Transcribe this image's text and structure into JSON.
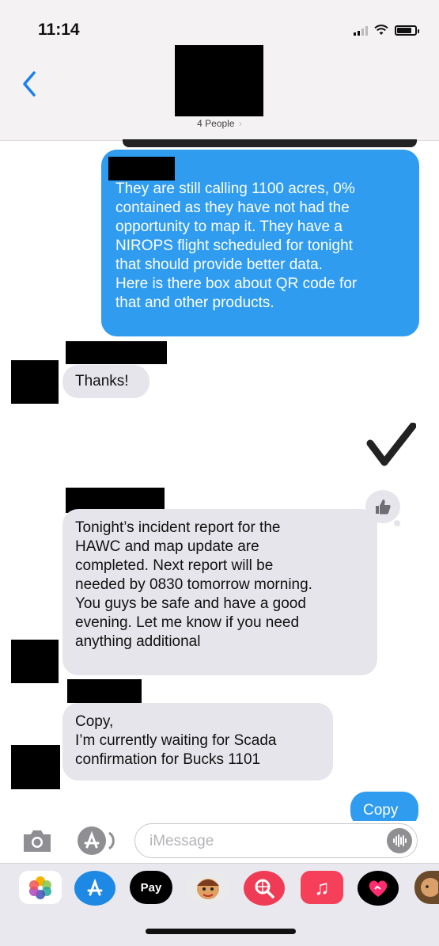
{
  "status_bar": {
    "time": "11:14"
  },
  "header": {
    "people_label": "4 People",
    "chevron": "›"
  },
  "messages": {
    "outgoing_1": {
      "lines": [
        "They are still calling 1100 acres, 0%",
        "contained as they have not had the",
        "opportunity to map it.  They have a",
        "NIROPS flight scheduled for tonight",
        "that should provide better data.",
        "Here is there box about QR code for",
        "that and other products."
      ]
    },
    "incoming_1": {
      "text": "Thanks!"
    },
    "incoming_2": {
      "lines": [
        "Tonight’s incident report for the",
        "HAWC and map update are",
        "completed. Next report will be",
        "needed by 0830 tomorrow morning.",
        "You guys be safe and have a good",
        "evening. Let me know if you need",
        "anything additional"
      ]
    },
    "incoming_3": {
      "lines": [
        "Copy,",
        "I’m currently waiting for Scada",
        "confirmation for Bucks 1101"
      ]
    },
    "outgoing_2": {
      "text": "Copy"
    }
  },
  "composer": {
    "placeholder": "iMessage"
  },
  "app_drawer": {
    "apps": [
      {
        "name": "photos-icon",
        "label": ""
      },
      {
        "name": "app-store-icon",
        "label": ""
      },
      {
        "name": "apple-pay-icon",
        "label": "Pay"
      },
      {
        "name": "memoji-icon",
        "label": ""
      },
      {
        "name": "search-images-icon",
        "label": ""
      },
      {
        "name": "music-icon",
        "label": "♫"
      },
      {
        "name": "digital-touch-icon",
        "label": ""
      },
      {
        "name": "memoji-2-icon",
        "label": ""
      }
    ]
  },
  "colors": {
    "outgoing_bubble": "#2f9cf0",
    "incoming_bubble": "#e6e5eb",
    "accent": "#1a7ff0"
  }
}
